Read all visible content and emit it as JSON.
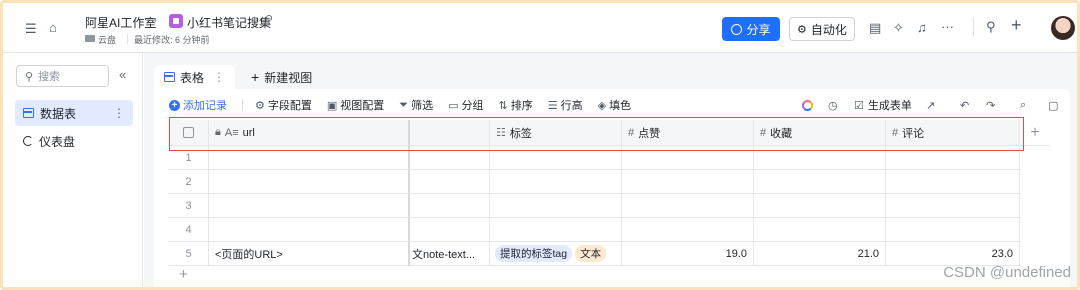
{
  "header": {
    "workspace": "阿星AI工作室",
    "doc_title": "小红书笔记搜集",
    "location": "云盘",
    "last_modified": "最近修改: 6 分钟前",
    "share_label": "分享",
    "automation_label": "自动化"
  },
  "sidebar": {
    "search_placeholder": "搜索",
    "items": [
      {
        "label": "数据表",
        "active": true
      },
      {
        "label": "仪表盘",
        "active": false
      }
    ]
  },
  "tabs": {
    "active_label": "表格",
    "new_view_label": "新建视图"
  },
  "toolbar": {
    "add_record": "添加记录",
    "field_config": "字段配置",
    "view_config": "视图配置",
    "filter": "筛选",
    "group": "分组",
    "sort": "排序",
    "row_height": "行高",
    "fill_color": "填色",
    "generate_form": "生成表单"
  },
  "table": {
    "columns": [
      {
        "label": "url",
        "icon": "text-icon"
      },
      {
        "label": "",
        "icon": ""
      },
      {
        "label": "标签",
        "icon": "multi-select-icon"
      },
      {
        "label": "点赞",
        "icon": "number-icon"
      },
      {
        "label": "收藏",
        "icon": "number-icon"
      },
      {
        "label": "评论",
        "icon": "number-icon"
      }
    ],
    "rows": [
      {
        "n": "1",
        "url": "",
        "text": "",
        "likes": "",
        "saves": "",
        "comments": ""
      },
      {
        "n": "2",
        "url": "",
        "text": "",
        "likes": "",
        "saves": "",
        "comments": ""
      },
      {
        "n": "3",
        "url": "",
        "text": "",
        "likes": "",
        "saves": "",
        "comments": ""
      },
      {
        "n": "4",
        "url": "",
        "text": "",
        "likes": "",
        "saves": "",
        "comments": ""
      },
      {
        "n": "5",
        "url": "<页面的URL>",
        "text": "文note-text...",
        "likes": "19.0",
        "saves": "21.0",
        "comments": "23.0"
      }
    ],
    "row5_tags": [
      {
        "label": "提取的标签tag",
        "color": "#e1eaff"
      },
      {
        "label": "文本",
        "color": "#fde9cf"
      }
    ]
  },
  "watermark": "CSDN @undefined",
  "colors": {
    "accent": "#1e6fff",
    "highlight": "#e84a4a",
    "frame": "#f7e3b5"
  }
}
